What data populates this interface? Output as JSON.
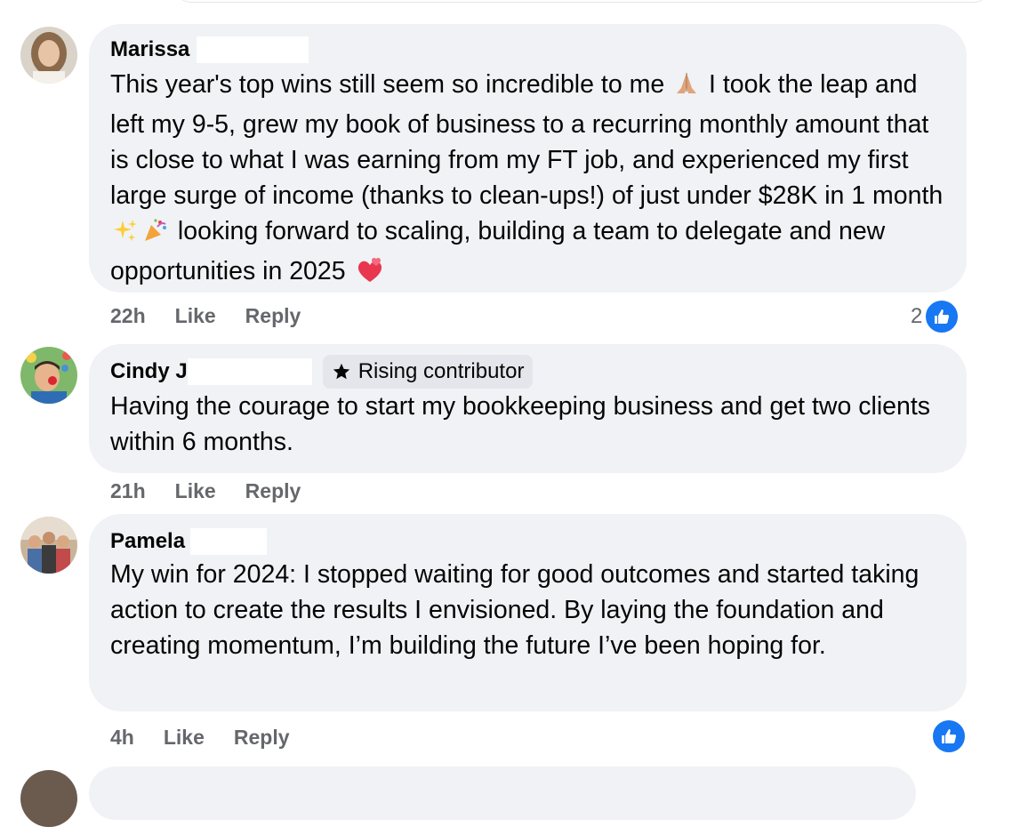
{
  "comments": [
    {
      "author": "Marissa",
      "badge": "",
      "text_parts": [
        "This year's top wins still seem so incredible to me ",
        " I took the leap and left my 9-5, grew my book of business to a recurring monthly amount that is close to what I was earning from my FT job, and experienced my first large surge of income (thanks to clean-ups!) of just under $28K in 1 month ",
        " looking forward to scaling, building a team to delegate and new opportunities in 2025 "
      ],
      "emojis": [
        "folded-hands-icon",
        "sparkles-icon",
        "party-popper-icon",
        "two-hearts-icon"
      ],
      "time": "22h",
      "like_label": "Like",
      "reply_label": "Reply",
      "reaction_count": "2"
    },
    {
      "author": "Cindy J",
      "badge": "Rising contributor",
      "text": "Having the courage to start my bookkeeping business and get two clients within 6 months.",
      "time": "21h",
      "like_label": "Like",
      "reply_label": "Reply",
      "reaction_count": ""
    },
    {
      "author": "Pamela",
      "badge": "",
      "text": "My win for 2024: I stopped waiting for good outcomes and started taking action to create the results I envisioned. By laying the foundation and creating momentum, I’m building the future I’ve been hoping for.",
      "time": "4h",
      "like_label": "Like",
      "reply_label": "Reply",
      "reaction_count": ""
    }
  ],
  "colors": {
    "bubble": "#f0f2f5",
    "meta_text": "#65676b",
    "like_blue": "#1877f2",
    "badge_bg": "#e4e6eb"
  }
}
